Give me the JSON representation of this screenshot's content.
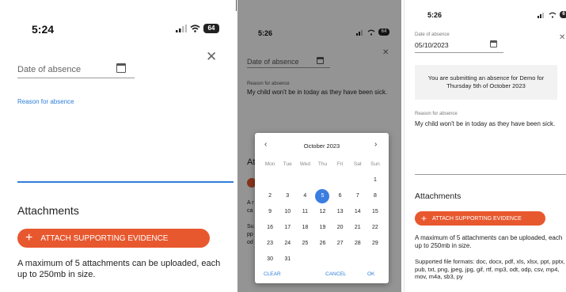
{
  "panel1": {
    "time": "5:24",
    "battery": "64",
    "date_label": "Date of absence",
    "reason_label": "Reason for absence",
    "attachments_heading": "Attachments",
    "attach_button": "ATTACH SUPPORTING EVIDENCE",
    "limit_text": "A maximum of 5 attachments can be uploaded, each up to 250mb in size."
  },
  "panel2": {
    "time": "5:26",
    "battery": "64",
    "date_label": "Date of absence",
    "reason_label": "Reason for absence",
    "reason_value": "My child won't be in today as they have been sick.",
    "behind_fragments": [
      "Att",
      "A r",
      "ca",
      "Su",
      "pp",
      "od"
    ],
    "calendar": {
      "month_label": "October 2023",
      "weekdays": [
        "Mon",
        "Tue",
        "Wed",
        "Thu",
        "Fri",
        "Sat",
        "Sun"
      ],
      "days": [
        "",
        "",
        "",
        "",
        "",
        "",
        "1",
        "2",
        "3",
        "4",
        "5",
        "6",
        "7",
        "8",
        "9",
        "10",
        "11",
        "12",
        "13",
        "14",
        "15",
        "16",
        "17",
        "18",
        "19",
        "20",
        "21",
        "22",
        "23",
        "24",
        "25",
        "26",
        "27",
        "28",
        "29",
        "30",
        "31",
        "",
        "",
        "",
        "",
        ""
      ],
      "selected_day": "5",
      "clear_label": "CLEAR",
      "cancel_label": "CANCEL",
      "ok_label": "OK"
    }
  },
  "panel3": {
    "time": "5:26",
    "battery": "6",
    "date_label": "Date of absence",
    "date_value": "05/10/2023",
    "info_text": "You are submitting an absence for Demo for Thursday 5th of October 2023",
    "reason_label": "Reason for absence",
    "reason_value": "My child won't be in today as they have been sick.",
    "attachments_heading": "Attachments",
    "attach_button": "ATTACH SUPPORTING EVIDENCE",
    "limit_text": "A maximum of 5 attachments can be uploaded, each up to 250mb in size.",
    "formats_text": "Supported file formats: doc, docx, pdf, xls, xlsx, ppt, pptx, pub, txt, png, jpeg, jpg, gif, rtf, mp3, odt, odp, csv, mp4, mov, m4a, sb3, py"
  },
  "colors": {
    "accent": "#e8582f",
    "link_blue": "#2f7fd8",
    "selected_day": "#3b7de0"
  }
}
